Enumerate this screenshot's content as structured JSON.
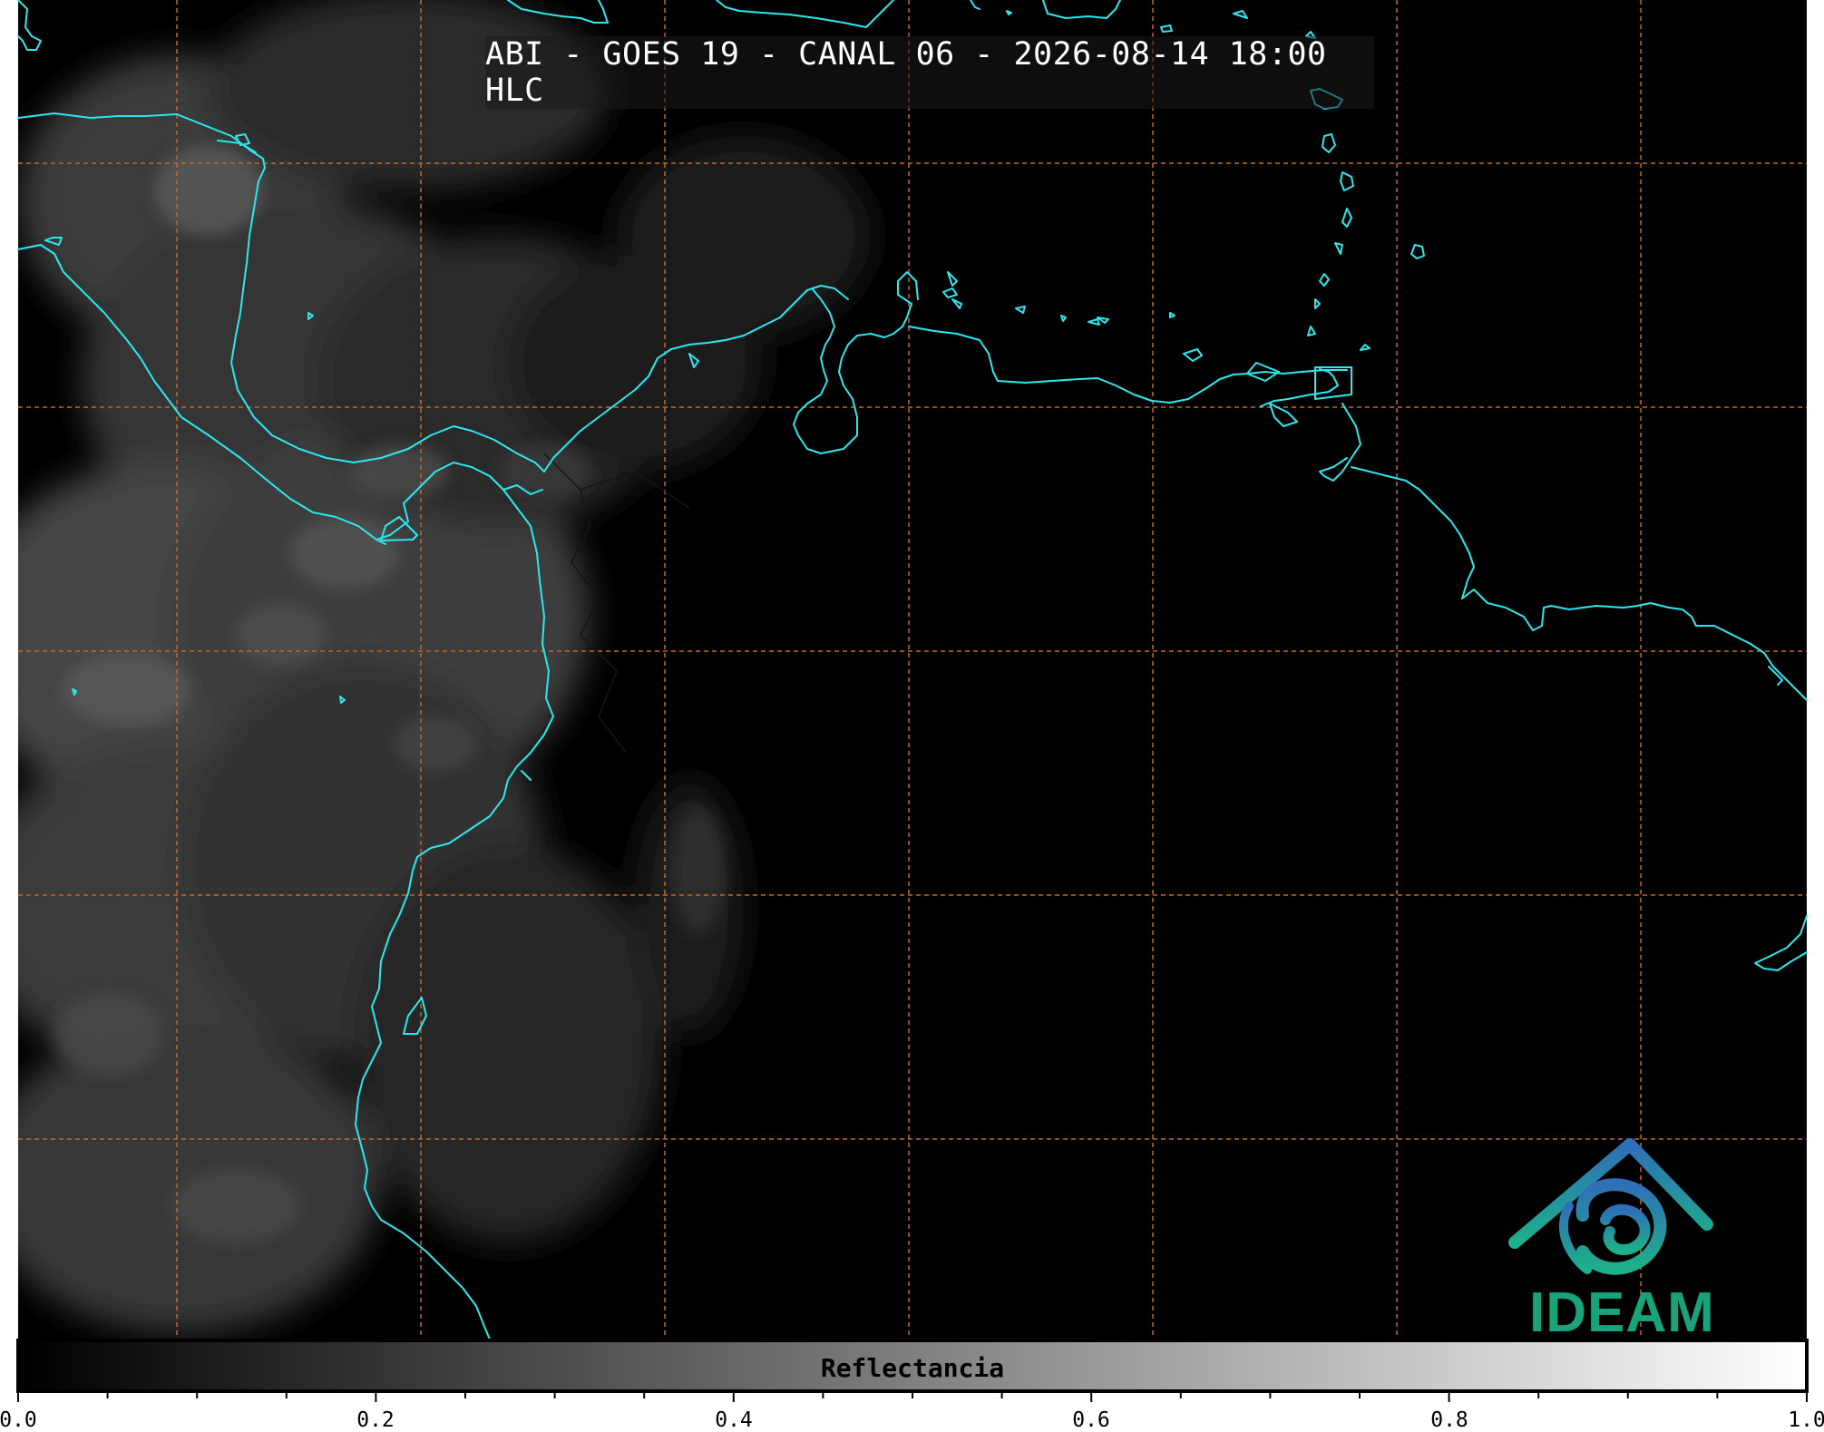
{
  "title": "ABI - GOES 19 - CANAL 06 - 2026-08-14 18:00 HLC",
  "colorbar": {
    "label": "Reflectancia",
    "ticks": [
      "0.0",
      "0.2",
      "0.4",
      "0.6",
      "0.8",
      "1.0"
    ],
    "range": [
      0.0,
      1.0
    ],
    "colormap": "greys"
  },
  "logo": {
    "text": "IDEAM"
  },
  "colors": {
    "background": "#000000",
    "coastline": "#2be8ee",
    "grid": "#c8672a",
    "borders": "#0a0a0a"
  }
}
